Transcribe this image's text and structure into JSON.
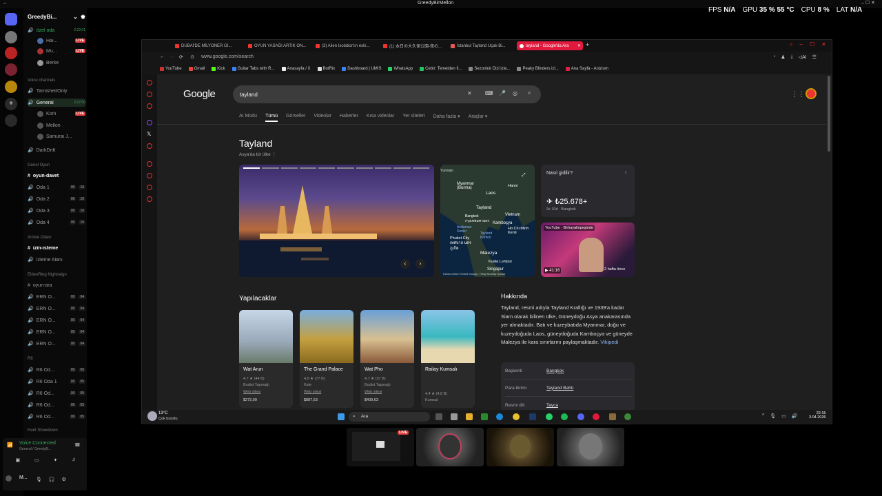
{
  "window_title": "GreedyBirMellon",
  "overlay": {
    "fps_label": "FPS",
    "fps_value": "N/A",
    "gpu_label": "GPU",
    "gpu_value": "35 % 55 °C",
    "cpu_label": "CPU",
    "cpu_value": "8 %",
    "lat_label": "LAT",
    "lat_value": "N/A"
  },
  "discord": {
    "server_name": "GreedyBi...",
    "channels": [
      {
        "name": "özel oda",
        "time": "2:22:01"
      },
      {
        "name": "Hai...",
        "badge": "LIVE"
      },
      {
        "name": "Mu...",
        "badge": "LIVE"
      },
      {
        "name": "Berke"
      },
      {
        "name": "Voice channels"
      },
      {
        "name": "TarnishedOnly"
      },
      {
        "name": "General",
        "time": "2:27:00"
      },
      {
        "name": "Korli",
        "badge": "LIVE"
      },
      {
        "name": "Mellon"
      },
      {
        "name": "Samurai J..."
      },
      {
        "name": "DarkDrift"
      },
      {
        "name": "Genel Oyun"
      },
      {
        "name": "oyun-davet"
      },
      {
        "name": "Oda 1",
        "c1": "00",
        "c2": "10"
      },
      {
        "name": "Oda 2",
        "c1": "00",
        "c2": "10"
      },
      {
        "name": "Oda 3",
        "c1": "00",
        "c2": "10"
      },
      {
        "name": "Oda 4",
        "c1": "00",
        "c2": "10"
      },
      {
        "name": "Anime Odası"
      },
      {
        "name": "izin-isteme"
      },
      {
        "name": "İzleme Alanı"
      },
      {
        "name": "EldenRing Nightreign"
      },
      {
        "name": "oyun-ara"
      },
      {
        "name": "ERN O...",
        "c1": "00",
        "c2": "04"
      },
      {
        "name": "ERN O...",
        "c1": "00",
        "c2": "04"
      },
      {
        "name": "ERN O...",
        "c1": "00",
        "c2": "04"
      },
      {
        "name": "ERN O...",
        "c1": "00",
        "c2": "04"
      },
      {
        "name": "ERN O...",
        "c1": "00",
        "c2": "04"
      },
      {
        "name": "R6"
      },
      {
        "name": "R6 Od...",
        "c1": "00",
        "c2": "05"
      },
      {
        "name": "R6 Oda 1",
        "c1": "00",
        "c2": "05"
      },
      {
        "name": "R6 Od...",
        "c1": "00",
        "c2": "05"
      },
      {
        "name": "R6 Od...",
        "c1": "00",
        "c2": "05"
      },
      {
        "name": "R6 Od...",
        "c1": "00",
        "c2": "05"
      },
      {
        "name": "Hunt Showdown"
      }
    ],
    "voice_status": "Voice Connected",
    "voice_sub": "General / GreedyB...",
    "user": "M..."
  },
  "browser": {
    "tabs": [
      "DUBAİ'DE MİLYONER Gİ...",
      "OYUN YASAĞI ARTIK ON...",
      "(3) Alien Isolation'ın eski...",
      "(1) 本日の大久保公園-夜の...",
      "İstanbul Tayland Uçak Bi...",
      "tayland - Google'da Ara"
    ],
    "url": "www.google.com/search",
    "bookmarks": [
      "YouTube",
      "Gmail",
      "Kick",
      "Guitar Tabs with R...",
      "Anasayfa / X",
      "BotRix",
      "Dashboard | UMIS",
      "WhatsApp",
      "Cebir: Temelden İl...",
      "Sezonluk Dizi izle...",
      "Peaky Blinders izl...",
      "Ana Sayfa - Anizium"
    ]
  },
  "google": {
    "logo": "Google",
    "query": "tayland",
    "nav": [
      "AI Modu",
      "Tümü",
      "Görseller",
      "Videolar",
      "Haberler",
      "Kısa videolar",
      "Yer siteleri",
      "Daha fazla ▾",
      "Araçlar ▾"
    ],
    "title": "Tayland",
    "subtitle": "Asya'da bir ülke",
    "map_labels": [
      "Yunnan",
      "Myanmar (Burma)",
      "Laos",
      "Hanoi",
      "Tayland",
      "Vietnam",
      "Bangkok กรุงเทพมหานคร",
      "Kamboçya",
      "Andaman Denizi",
      "Ho Chi Minh Kenti",
      "Phuket City เทศบาล นครภูเก็ต",
      "Tayland Körfezi",
      "Malezya",
      "Kuala Lumpur",
      "Singapur"
    ],
    "map_attr": "Harita verileri ©2026 Google, TMap Mobility   Şartlar",
    "fly_q": "Nasıl gidilir?",
    "fly_price": "✈ ₺25.678+",
    "fly_sub": "9s 10d · Bangkok",
    "video_source": "YouTube · Birhayalinpeşinde",
    "video_duration": "▶ 41:16",
    "video_age": "2 hafta önce",
    "todo_title": "Yapılacaklar",
    "cards": [
      {
        "name": "Wat Arun",
        "rating": "4,7 ★ (44 B)",
        "type": "Budist Tapınağı",
        "link": "Web sitesi",
        "price": "$273,09"
      },
      {
        "name": "The Grand Palace",
        "rating": "4,6 ★ (77 B)",
        "type": "Kale",
        "link": "Web sitesi",
        "price": "$887,53"
      },
      {
        "name": "Wat Pho",
        "rating": "4,7 ★ (37 B)",
        "type": "Budist Tapınağı",
        "link": "Web sitesi",
        "price": "$409,63"
      },
      {
        "name": "Railay Kumsalı",
        "rating": "4,4 ★ (4,8 B)",
        "type": "Kumsal",
        "link": "",
        "price": ""
      }
    ],
    "about_title": "Hakkında",
    "about_text": "Tayland, resmi adıyla Tayland Krallığı ve 1939'a kadar Siam olarak bilinen ülke, Güneydoğu Asya anakarasında yer almaktadır. Batı ve kuzeybatıda Myanmar, doğu ve kuzeydoğuda Laos, güneydoğuda Kamboçya ve güneyde Malezya ile kara sınırlarını paylaşmaktadır.",
    "about_link": "Vikipedi",
    "facts": [
      {
        "k": "Başkenti",
        "v": "Bangkok"
      },
      {
        "k": "Para birimi",
        "v": "Tayland Bahtı"
      },
      {
        "k": "Resmi dili",
        "v": "Tayca"
      }
    ]
  },
  "taskbar": {
    "weather_temp": "13°C",
    "weather_desc": "Çok bulutlu",
    "search": "Ara",
    "time": "22:15",
    "date": "3.04.2026"
  },
  "cam_live": "LIVE",
  "colors": {
    "accent": "#e0193d",
    "live": "#e03b3b",
    "link": "#8ab4f8",
    "online": "#3ba55d"
  }
}
